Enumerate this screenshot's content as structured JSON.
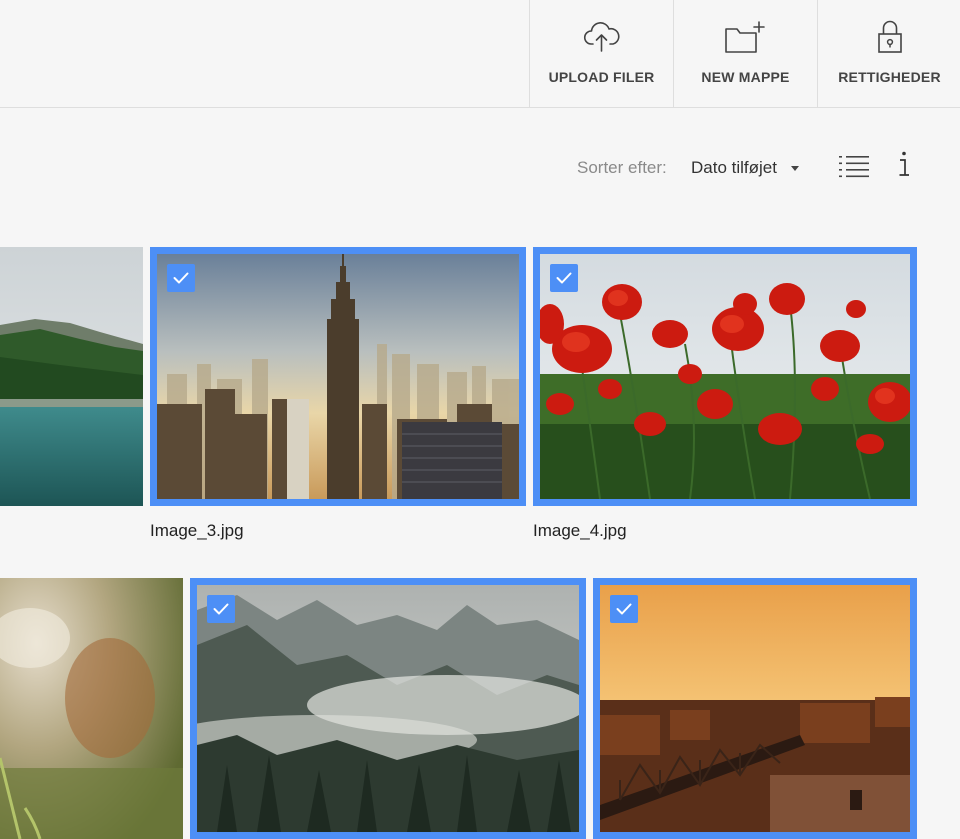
{
  "toolbar": {
    "upload": {
      "label": "UPLOAD FILER",
      "icon": "cloud-upload-icon"
    },
    "new_folder": {
      "label": "NEW MAPPE",
      "icon": "folder-plus-icon"
    },
    "rights": {
      "label": "RETTIGHEDER",
      "icon": "lock-icon"
    }
  },
  "sort": {
    "label": "Sorter efter:",
    "value": "Dato tilføjet"
  },
  "view_controls": {
    "list_view_icon": "list-view-icon",
    "info_icon": "info-icon"
  },
  "images": [
    {
      "filename": "",
      "selected": false,
      "subject": "mountain lake"
    },
    {
      "filename": "Image_3.jpg",
      "selected": true,
      "subject": "city skyline"
    },
    {
      "filename": "Image_4.jpg",
      "selected": true,
      "subject": "red poppies"
    },
    {
      "filename": "",
      "selected": false,
      "subject": "blurred grass"
    },
    {
      "filename": "",
      "selected": true,
      "subject": "misty forest mountains"
    },
    {
      "filename": "",
      "selected": true,
      "subject": "bridge at sunset"
    }
  ],
  "colors": {
    "accent": "#4d8ff6",
    "background": "#f6f6f6",
    "divider": "#dedede"
  }
}
